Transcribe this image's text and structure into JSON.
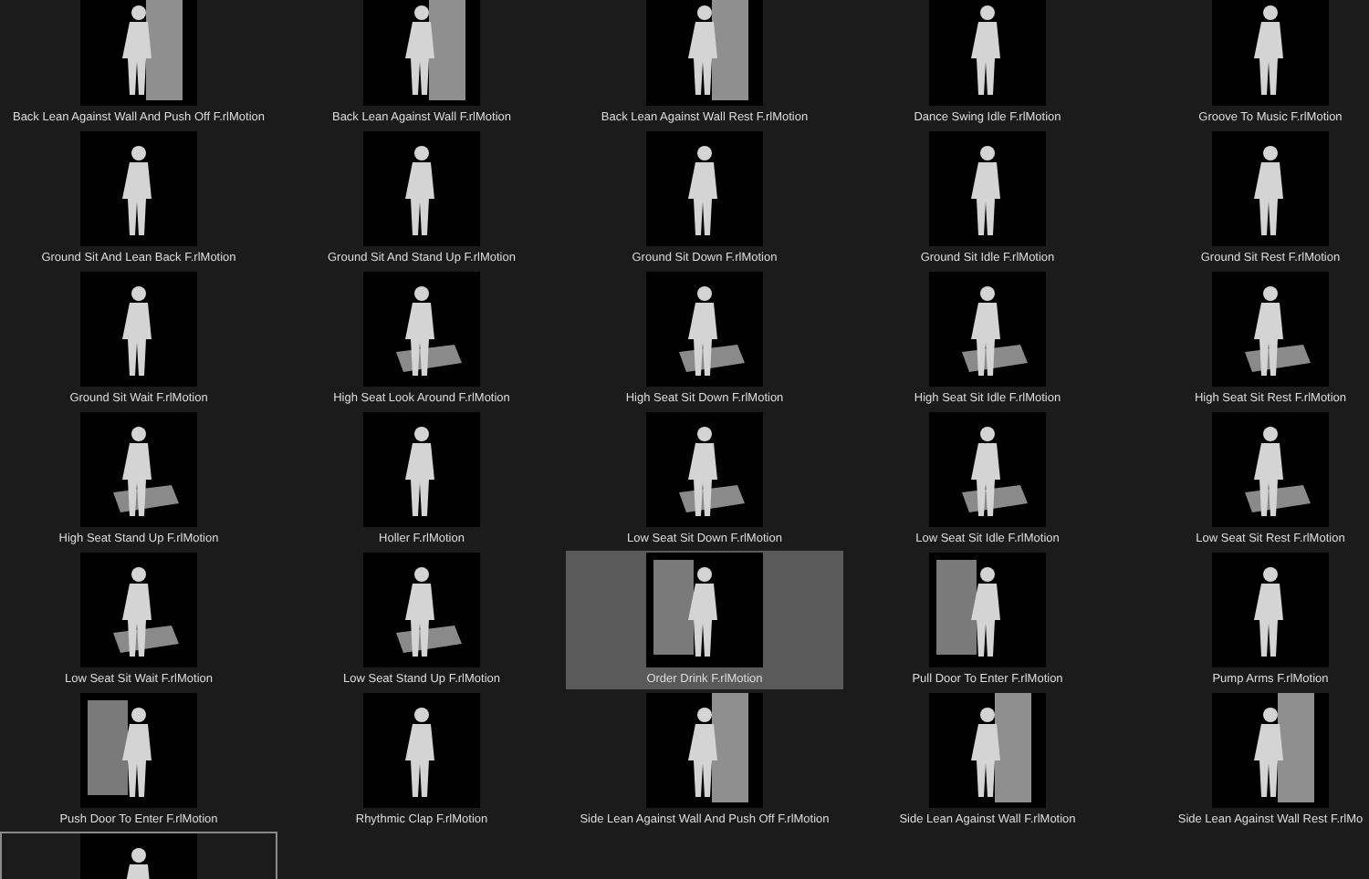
{
  "motions": [
    {
      "label": "Back Lean Against Wall And Push Off F.rlMotion",
      "kind": "wall",
      "selected": false
    },
    {
      "label": "Back Lean Against Wall F.rlMotion",
      "kind": "wall",
      "selected": false
    },
    {
      "label": "Back Lean Against Wall Rest F.rlMotion",
      "kind": "wall",
      "selected": false
    },
    {
      "label": "Dance Swing Idle F.rlMotion",
      "kind": "plain",
      "selected": false
    },
    {
      "label": "Groove To Music F.rlMotion",
      "kind": "plain",
      "selected": false
    },
    {
      "label": "Ground Sit And Lean Back F.rlMotion",
      "kind": "plain",
      "selected": false
    },
    {
      "label": "Ground Sit And Stand Up F.rlMotion",
      "kind": "plain",
      "selected": false
    },
    {
      "label": "Ground Sit Down F.rlMotion",
      "kind": "plain",
      "selected": false
    },
    {
      "label": "Ground Sit Idle F.rlMotion",
      "kind": "plain",
      "selected": false
    },
    {
      "label": "Ground Sit Rest F.rlMotion",
      "kind": "plain",
      "selected": false
    },
    {
      "label": "Ground Sit Wait F.rlMotion",
      "kind": "plain",
      "selected": false
    },
    {
      "label": "High Seat Look Around F.rlMotion",
      "kind": "seat",
      "selected": false
    },
    {
      "label": "High Seat Sit Down F.rlMotion",
      "kind": "seat",
      "selected": false
    },
    {
      "label": "High Seat Sit Idle F.rlMotion",
      "kind": "seat",
      "selected": false
    },
    {
      "label": "High Seat Sit Rest F.rlMotion",
      "kind": "seat",
      "selected": false
    },
    {
      "label": "High Seat Stand Up F.rlMotion",
      "kind": "seat",
      "selected": false
    },
    {
      "label": "Holler F.rlMotion",
      "kind": "plain",
      "selected": false
    },
    {
      "label": "Low Seat Sit Down F.rlMotion",
      "kind": "seat",
      "selected": false
    },
    {
      "label": "Low Seat Sit Idle F.rlMotion",
      "kind": "seat",
      "selected": false
    },
    {
      "label": "Low Seat Sit Rest F.rlMotion",
      "kind": "seat",
      "selected": false
    },
    {
      "label": "Low Seat Sit Wait F.rlMotion",
      "kind": "seat",
      "selected": false
    },
    {
      "label": "Low Seat Stand Up F.rlMotion",
      "kind": "seat",
      "selected": false
    },
    {
      "label": "Order Drink F.rlMotion",
      "kind": "door",
      "selected": true
    },
    {
      "label": "Pull Door To Enter F.rlMotion",
      "kind": "door",
      "selected": false
    },
    {
      "label": "Pump Arms F.rlMotion",
      "kind": "plain",
      "selected": false
    },
    {
      "label": "Push Door To Enter F.rlMotion",
      "kind": "door",
      "selected": false
    },
    {
      "label": "Rhythmic Clap F.rlMotion",
      "kind": "plain",
      "selected": false
    },
    {
      "label": "Side Lean Against Wall And Push Off F.rlMotion",
      "kind": "wall",
      "selected": false
    },
    {
      "label": "Side Lean Against Wall F.rlMotion",
      "kind": "wall",
      "selected": false
    },
    {
      "label": "Side Lean Against Wall Rest F.rlMo",
      "kind": "wall",
      "selected": false
    }
  ],
  "partial_item": {
    "focused": true
  }
}
